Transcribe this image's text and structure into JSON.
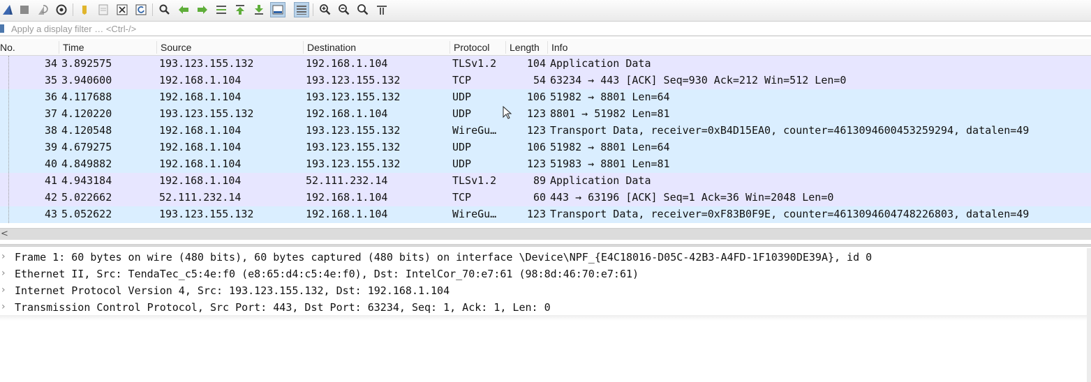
{
  "colors": {
    "row_tls": "#e7e6ff",
    "row_tcp": "#e7e6ff",
    "row_udp": "#daeeff",
    "row_wireguard": "#daeeff",
    "toolbar_bg": "#eaeaea"
  },
  "toolbar": {
    "buttons": [
      "shark-fin-start-icon",
      "stop-square-icon",
      "restart-fin-icon",
      "capture-options-gear-icon",
      "open-folder-icon",
      "save-file-icon",
      "close-file-icon",
      "reload-file-icon",
      "find-magnifier-icon",
      "go-back-arrow-icon",
      "go-forward-arrow-icon",
      "go-to-packet-icon",
      "go-first-packet-icon",
      "go-last-packet-icon",
      "autoscroll-icon",
      "colorize-icon",
      "zoom-in-icon",
      "zoom-out-icon",
      "zoom-normal-icon",
      "resize-columns-icon"
    ]
  },
  "filter": {
    "placeholder": "Apply a display filter … <Ctrl-/>"
  },
  "packet_list": {
    "columns": {
      "no": "No.",
      "time": "Time",
      "source": "Source",
      "destination": "Destination",
      "protocol": "Protocol",
      "length": "Length",
      "info": "Info"
    },
    "rows": [
      {
        "no": "34",
        "time": "3.892575",
        "source": "193.123.155.132",
        "destination": "192.168.1.104",
        "protocol": "TLSv1.2",
        "length": "104",
        "info": "Application Data",
        "kind": "tls"
      },
      {
        "no": "35",
        "time": "3.940600",
        "source": "192.168.1.104",
        "destination": "193.123.155.132",
        "protocol": "TCP",
        "length": "54",
        "info": "63234 → 443 [ACK] Seq=930 Ack=212 Win=512 Len=0",
        "kind": "tcp"
      },
      {
        "no": "36",
        "time": "4.117688",
        "source": "192.168.1.104",
        "destination": "193.123.155.132",
        "protocol": "UDP",
        "length": "106",
        "info": "51982 → 8801 Len=64",
        "kind": "udp"
      },
      {
        "no": "37",
        "time": "4.120220",
        "source": "193.123.155.132",
        "destination": "192.168.1.104",
        "protocol": "UDP",
        "length": "123",
        "info": "8801 → 51982 Len=81",
        "kind": "udp"
      },
      {
        "no": "38",
        "time": "4.120548",
        "source": "192.168.1.104",
        "destination": "193.123.155.132",
        "protocol": "WireGu…",
        "length": "123",
        "info": "Transport Data, receiver=0xB4D15EA0, counter=4613094600453259294, datalen=49",
        "kind": "wireguard"
      },
      {
        "no": "39",
        "time": "4.679275",
        "source": "192.168.1.104",
        "destination": "193.123.155.132",
        "protocol": "UDP",
        "length": "106",
        "info": "51982 → 8801 Len=64",
        "kind": "udp"
      },
      {
        "no": "40",
        "time": "4.849882",
        "source": "192.168.1.104",
        "destination": "193.123.155.132",
        "protocol": "UDP",
        "length": "123",
        "info": "51983 → 8801 Len=81",
        "kind": "udp"
      },
      {
        "no": "41",
        "time": "4.943184",
        "source": "192.168.1.104",
        "destination": "52.111.232.14",
        "protocol": "TLSv1.2",
        "length": "89",
        "info": "Application Data",
        "kind": "tls"
      },
      {
        "no": "42",
        "time": "5.022662",
        "source": "52.111.232.14",
        "destination": "192.168.1.104",
        "protocol": "TCP",
        "length": "60",
        "info": "443 → 63196 [ACK] Seq=1 Ack=36 Win=2048 Len=0",
        "kind": "tcp"
      },
      {
        "no": "43",
        "time": "5.052622",
        "source": "193.123.155.132",
        "destination": "192.168.1.104",
        "protocol": "WireGu…",
        "length": "123",
        "info": "Transport Data, receiver=0xF83B0F9E, counter=4613094604748226803, datalen=49",
        "kind": "wireguard"
      }
    ]
  },
  "scrollbar": {
    "left_arrow": "<"
  },
  "details": {
    "rows": [
      {
        "arrow": "›",
        "text": "Frame 1: 60 bytes on wire (480 bits), 60 bytes captured (480 bits) on interface \\Device\\NPF_{E4C18016-D05C-42B3-A4FD-1F10390DE39A}, id 0"
      },
      {
        "arrow": "›",
        "text": "Ethernet II, Src: TendaTec_c5:4e:f0 (e8:65:d4:c5:4e:f0), Dst: IntelCor_70:e7:61 (98:8d:46:70:e7:61)"
      },
      {
        "arrow": "›",
        "text": "Internet Protocol Version 4, Src: 193.123.155.132, Dst: 192.168.1.104"
      },
      {
        "arrow": "›",
        "text": "Transmission Control Protocol, Src Port: 443, Dst Port: 63234, Seq: 1, Ack: 1, Len: 0"
      }
    ]
  }
}
